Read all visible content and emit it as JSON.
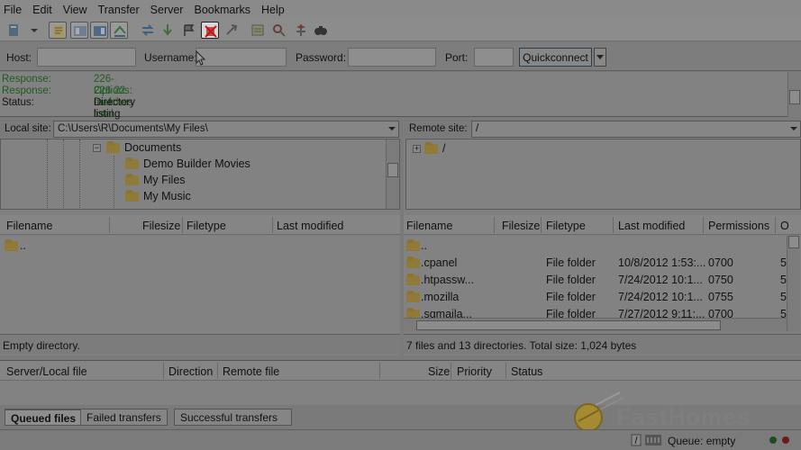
{
  "menu": [
    "File",
    "Edit",
    "View",
    "Transfer",
    "Server",
    "Bookmarks",
    "Help"
  ],
  "quickconnect": {
    "host_label": "Host:",
    "username_label": "Username:",
    "password_label": "Password:",
    "port_label": "Port:",
    "button": "Quickconnect",
    "host_value": "",
    "username_value": "",
    "password_value": "",
    "port_value": ""
  },
  "log": [
    {
      "label": "Response:",
      "text": "226-Options: -a -l"
    },
    {
      "label": "Response:",
      "text": "226 22 matches total"
    },
    {
      "label": "Status:",
      "text": "Directory listing successful"
    }
  ],
  "local": {
    "site_label": "Local site:",
    "path": "C:\\Users\\R\\Documents\\My Files\\",
    "tree": [
      "Documents",
      "Demo Builder Movies",
      "My Files",
      "My Music"
    ],
    "columns": [
      "Filename",
      "Filesize",
      "Filetype",
      "Last modified"
    ],
    "files": [
      ".."
    ],
    "status": "Empty directory."
  },
  "remote": {
    "site_label": "Remote site:",
    "path": "/",
    "tree": [
      "/"
    ],
    "columns": [
      "Filename",
      "Filesize",
      "Filetype",
      "Last modified",
      "Permissions",
      "O"
    ],
    "files": [
      {
        "name": "..",
        "type": "",
        "modified": "",
        "perm": "",
        "owner": ""
      },
      {
        "name": ".cpanel",
        "type": "File folder",
        "modified": "10/8/2012 1:53:...",
        "perm": "0700",
        "owner": "5"
      },
      {
        "name": ".htpassw...",
        "type": "File folder",
        "modified": "7/24/2012 10:1...",
        "perm": "0750",
        "owner": "5"
      },
      {
        "name": ".mozilla",
        "type": "File folder",
        "modified": "7/24/2012 10:1...",
        "perm": "0755",
        "owner": "5"
      },
      {
        "name": ".sqmaila...",
        "type": "File folder",
        "modified": "7/27/2012 9:11:...",
        "perm": "0700",
        "owner": "5"
      }
    ],
    "status": "7 files and 13 directories. Total size: 1,024 bytes"
  },
  "queue": {
    "columns": [
      "Server/Local file",
      "Direction",
      "Remote file",
      "Size",
      "Priority",
      "Status"
    ],
    "tabs": [
      "Queued files",
      "Failed transfers",
      "Successful transfers"
    ]
  },
  "statusbar": {
    "queue": "Queue: empty"
  },
  "watermark": "FastHomes",
  "colors": {
    "log_green": "#205a20",
    "folder": "#8f7a38",
    "highlight": "#c9c9c9"
  }
}
